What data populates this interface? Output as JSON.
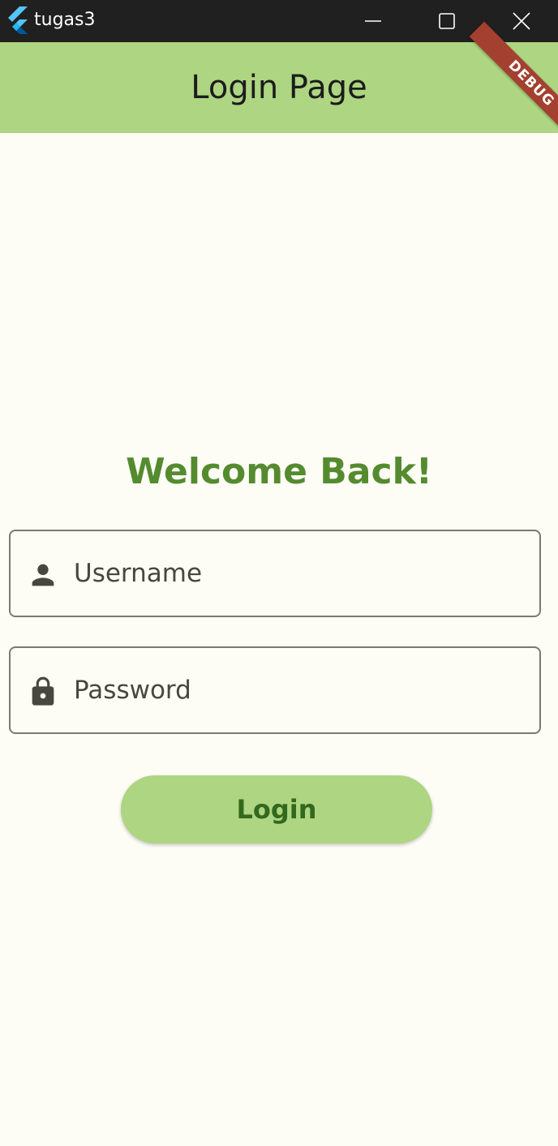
{
  "window": {
    "title": "tugas3",
    "icon": "flutter-logo-icon",
    "controls": {
      "minimize_icon": "minimize-icon",
      "maximize_icon": "maximize-icon",
      "close_icon": "close-icon"
    }
  },
  "appbar": {
    "title": "Login Page",
    "background": "#aed581"
  },
  "debug_banner": {
    "label": "DEBUG",
    "color": "#a3402f"
  },
  "form": {
    "heading": "Welcome Back!",
    "heading_color": "#558b2f",
    "username": {
      "placeholder": "Username",
      "value": "",
      "icon": "person-icon"
    },
    "password": {
      "placeholder": "Password",
      "value": "",
      "icon": "lock-icon"
    },
    "login_button": {
      "label": "Login",
      "background": "#aed581",
      "text_color": "#33691e"
    }
  },
  "colors": {
    "page_background": "#fdfcf5",
    "titlebar_background": "#202020",
    "field_border": "#7a7a72",
    "icon_color": "#47473f"
  }
}
